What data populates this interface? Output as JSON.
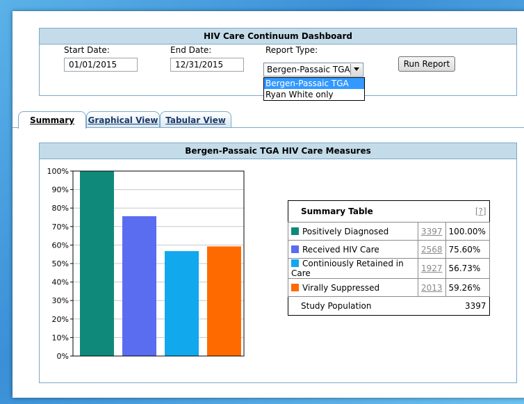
{
  "filter_panel": {
    "title": "HIV Care Continuum Dashboard",
    "start_date_label": "Start Date:",
    "start_date_value": "01/01/2015",
    "end_date_label": "End Date:",
    "end_date_value": "12/31/2015",
    "report_type_label": "Report Type:",
    "report_type_value": "Bergen-Passaic TGA",
    "report_type_options": [
      "Bergen-Passaic TGA",
      "Ryan White only"
    ],
    "run_button": "Run Report"
  },
  "tabs": [
    {
      "label": "Summary",
      "active": true
    },
    {
      "label": "Graphical View",
      "active": false
    },
    {
      "label": "Tabular View",
      "active": false
    }
  ],
  "measures_panel": {
    "title": "Bergen-Passaic TGA HIV Care Measures"
  },
  "chart_data": {
    "type": "bar",
    "categories": [
      "Positively Diagnosed",
      "Received HIV Care",
      "Continiously Retained in Care",
      "Virally Suppressed"
    ],
    "values": [
      100.0,
      75.6,
      56.73,
      59.26
    ],
    "colors": [
      "#0f8a7a",
      "#5a6cf0",
      "#11a8ee",
      "#ff6a00"
    ],
    "ylim": [
      0,
      100
    ],
    "yticks": [
      "0%",
      "10%",
      "20%",
      "30%",
      "40%",
      "50%",
      "60%",
      "70%",
      "80%",
      "90%",
      "100%"
    ],
    "grid": true,
    "title": "",
    "xlabel": "",
    "ylabel": ""
  },
  "summary_table": {
    "title": "Summary Table",
    "help": "[?]",
    "rows": [
      {
        "label": "Positively Diagnosed",
        "count": "3397",
        "percent": "100.00%",
        "color": "#0f8a7a"
      },
      {
        "label": "Received HIV Care",
        "count": "2568",
        "percent": "75.60%",
        "color": "#5a6cf0"
      },
      {
        "label": "Continiously Retained in Care",
        "count": "1927",
        "percent": "56.73%",
        "color": "#11a8ee"
      },
      {
        "label": "Virally Suppressed",
        "count": "2013",
        "percent": "59.26%",
        "color": "#ff6a00"
      }
    ],
    "footer_label": "Study Population",
    "footer_value": "3397"
  }
}
